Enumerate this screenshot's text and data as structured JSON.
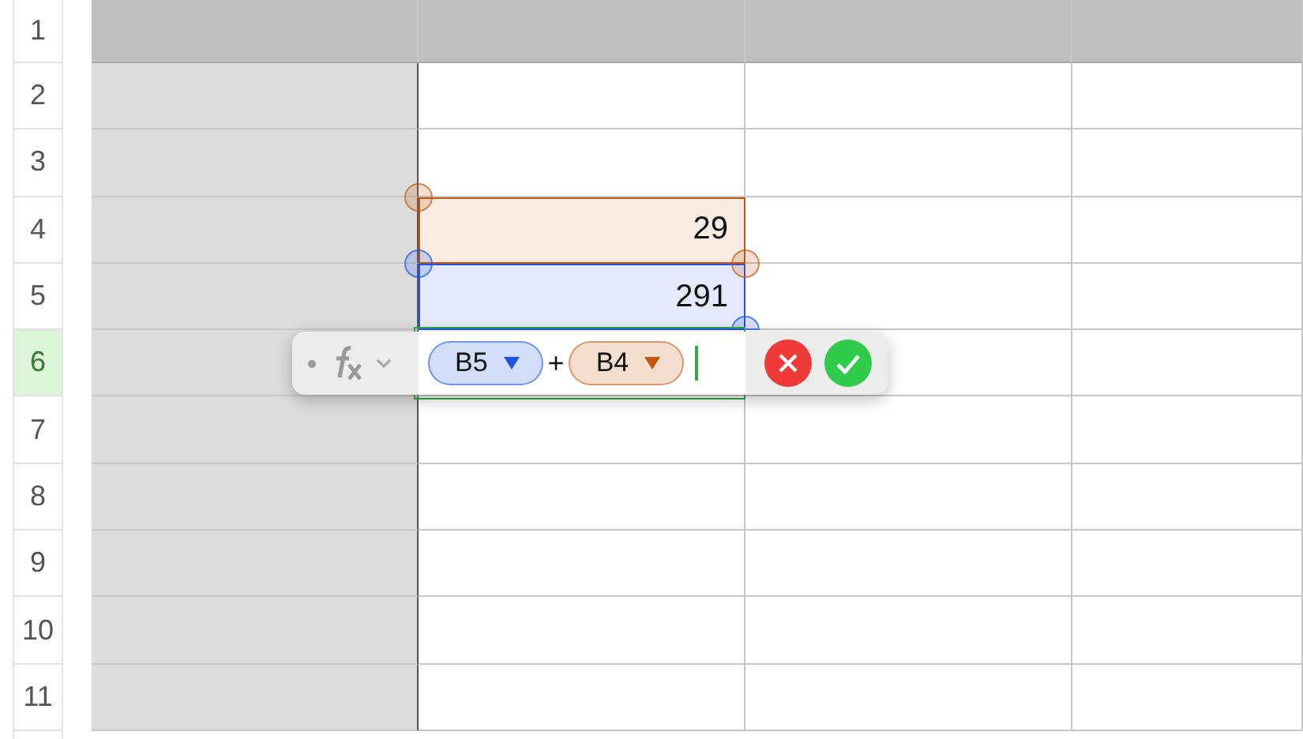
{
  "rows": [
    {
      "number": "1",
      "selected": false
    },
    {
      "number": "2",
      "selected": false
    },
    {
      "number": "3",
      "selected": false
    },
    {
      "number": "4",
      "selected": false,
      "value": "29",
      "color": "#c15a0f"
    },
    {
      "number": "5",
      "selected": false,
      "value": "291",
      "color": "#1f55e0"
    },
    {
      "number": "6",
      "selected": true
    },
    {
      "number": "7",
      "selected": false
    },
    {
      "number": "8",
      "selected": false
    },
    {
      "number": "9",
      "selected": false
    },
    {
      "number": "10",
      "selected": false
    },
    {
      "number": "11",
      "selected": false
    }
  ],
  "formula_bar": {
    "tokens": [
      {
        "kind": "ref",
        "text": "B5",
        "color": "#1f55e0"
      },
      {
        "kind": "op",
        "text": "+"
      },
      {
        "kind": "ref",
        "text": "B4",
        "color": "#c15a0f"
      }
    ]
  }
}
